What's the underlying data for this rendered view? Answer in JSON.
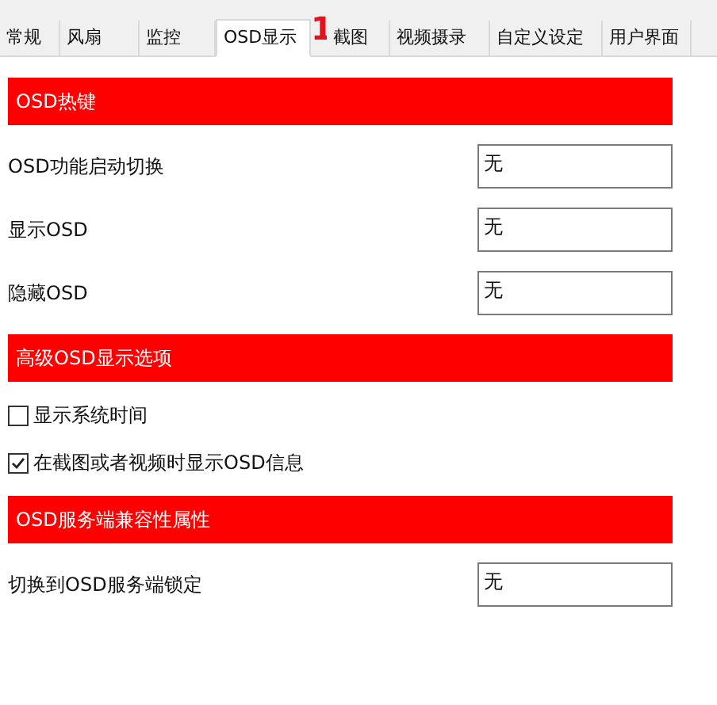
{
  "tabs": [
    {
      "label": "常规",
      "selected": false
    },
    {
      "label": "风扇",
      "selected": false
    },
    {
      "label": "监控",
      "selected": false
    },
    {
      "label": "OSD显示",
      "selected": true
    },
    {
      "label": "截图",
      "selected": false
    },
    {
      "label": "视频摄录",
      "selected": false
    },
    {
      "label": "自定义设定",
      "selected": false
    },
    {
      "label": "用户界面",
      "selected": false
    }
  ],
  "annotation": "1",
  "sections": [
    {
      "title": "OSD热键",
      "rows": [
        {
          "kind": "hotkey",
          "label": "OSD功能启动切换",
          "value": "无"
        },
        {
          "kind": "hotkey",
          "label": "显示OSD",
          "value": "无"
        },
        {
          "kind": "hotkey",
          "label": "隐藏OSD",
          "value": "无"
        }
      ]
    },
    {
      "title": "高级OSD显示选项",
      "rows": [
        {
          "kind": "checkbox",
          "label": "显示系统时间",
          "checked": false
        },
        {
          "kind": "checkbox",
          "label": "在截图或者视频时显示OSD信息",
          "checked": true
        }
      ]
    },
    {
      "title": "OSD服务端兼容性属性",
      "rows": [
        {
          "kind": "hotkey",
          "label": "切换到OSD服务端锁定",
          "value": "无"
        }
      ]
    }
  ]
}
